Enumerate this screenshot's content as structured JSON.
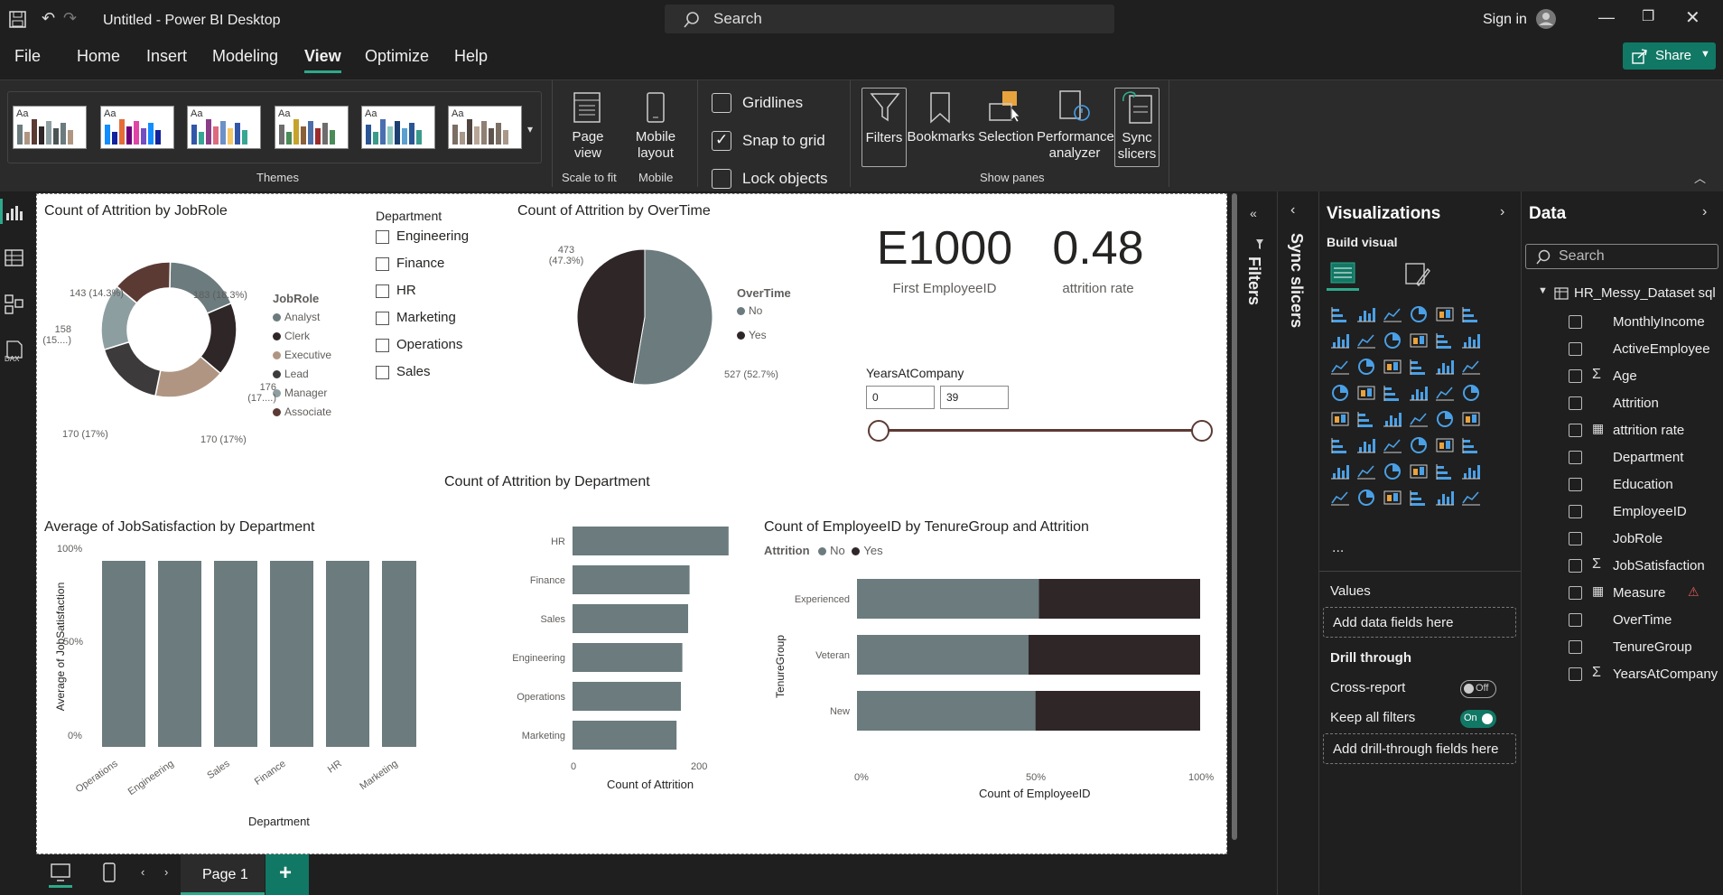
{
  "app": {
    "title": "Untitled - Power BI Desktop",
    "search_placeholder": "Search",
    "sign_in": "Sign in"
  },
  "menu": {
    "items": [
      "File",
      "Home",
      "Insert",
      "Modeling",
      "View",
      "Optimize",
      "Help"
    ],
    "active": "View",
    "share": "Share"
  },
  "ribbon": {
    "themes_label": "Themes",
    "theme_text": "Aa",
    "page_view": "Page view",
    "scale_to_fit": "Scale to fit",
    "mobile_layout": "Mobile layout",
    "mobile": "Mobile",
    "gridlines": "Gridlines",
    "snap_to_grid": "Snap to grid",
    "lock_objects": "Lock objects",
    "gridlines_checked": false,
    "snap_checked": true,
    "lock_checked": false,
    "panes": [
      "Filters",
      "Bookmarks",
      "Selection",
      "Performance analyzer",
      "Sync slicers"
    ],
    "show_panes": "Show panes"
  },
  "report": {
    "donut": {
      "title": "Count of Attrition by JobRole",
      "legend_title": "JobRole",
      "legend": [
        "Analyst",
        "Clerk",
        "Executive",
        "Lead",
        "Manager",
        "Associate"
      ],
      "labels": [
        "183 (18.3%)",
        "176 (17....)",
        "170 (17%)",
        "170 (17%)",
        "158 (15....)",
        "143 (14.3%)"
      ]
    },
    "dept_slicer": {
      "title": "Department",
      "items": [
        "Engineering",
        "Finance",
        "HR",
        "Marketing",
        "Operations",
        "Sales"
      ]
    },
    "pie": {
      "title": "Count of Attrition by OverTime",
      "legend_title": "OverTime",
      "legend": [
        "No",
        "Yes"
      ],
      "labels": [
        "473 (47.3%)",
        "527 (52.7%)"
      ]
    },
    "card1": {
      "value": "E1000",
      "label": "First EmployeeID"
    },
    "card2": {
      "value": "0.48",
      "label": "attrition rate"
    },
    "years_slicer": {
      "title": "YearsAtCompany",
      "min": "0",
      "max": "39"
    },
    "bar_dept": {
      "title": "Count of Attrition by Department",
      "xlabel": "Count of Attrition",
      "ticks": [
        "0",
        "200"
      ]
    },
    "col_sat": {
      "title": "Average of JobSatisfaction by Department",
      "ylabel": "Average of JobSatisfaction",
      "xlabel": "Department",
      "yticks": [
        "100%",
        "50%",
        "0%"
      ]
    },
    "stacked": {
      "title": "Count of EmployeeID by TenureGroup and Attrition",
      "legend_title": "Attrition",
      "legend": [
        "No",
        "Yes"
      ],
      "ylabel": "TenureGroup",
      "xlabel": "Count of EmployeeID",
      "ticks": [
        "0%",
        "50%",
        "100%"
      ]
    }
  },
  "chart_data": [
    {
      "type": "pie",
      "title": "Count of Attrition by JobRole",
      "categories": [
        "Analyst",
        "Clerk",
        "Executive",
        "Lead",
        "Manager",
        "Associate"
      ],
      "values": [
        183,
        176,
        170,
        170,
        158,
        143
      ],
      "colors": [
        "#6b7b7e",
        "#2f2628",
        "#b09682",
        "#3d3a3b",
        "#8d9ea1",
        "#5c3a34"
      ]
    },
    {
      "type": "pie",
      "title": "Count of Attrition by OverTime",
      "categories": [
        "No",
        "Yes"
      ],
      "values": [
        527,
        473
      ],
      "colors": [
        "#6b7b7e",
        "#2f2628"
      ]
    },
    {
      "type": "bar",
      "title": "Count of Attrition by Department",
      "categories": [
        "HR",
        "Finance",
        "Sales",
        "Engineering",
        "Operations",
        "Marketing"
      ],
      "values": [
        216,
        162,
        160,
        152,
        150,
        144
      ],
      "xlim": [
        0,
        240
      ],
      "xlabel": "Count of Attrition"
    },
    {
      "type": "bar",
      "title": "Average of JobSatisfaction by Department",
      "categories": [
        "Operations",
        "Engineering",
        "Sales",
        "Finance",
        "HR",
        "Marketing"
      ],
      "values": [
        100,
        100,
        100,
        100,
        100,
        100
      ],
      "ylim": [
        0,
        100
      ],
      "xlabel": "Department",
      "ylabel": "Average of JobSatisfaction"
    },
    {
      "type": "bar",
      "title": "Count of EmployeeID by TenureGroup and Attrition",
      "categories": [
        "Experienced",
        "Veteran",
        "New"
      ],
      "series": [
        {
          "name": "No",
          "values": [
            53,
            50,
            52
          ]
        },
        {
          "name": "Yes",
          "values": [
            47,
            50,
            48
          ]
        }
      ],
      "xlim": [
        0,
        100
      ],
      "xlabel": "Count of EmployeeID",
      "ylabel": "TenureGroup"
    }
  ],
  "pagebar": {
    "page": "Page 1"
  },
  "panes": {
    "filters": "Filters",
    "sync": "Sync slicers"
  },
  "viz": {
    "title": "Visualizations",
    "build": "Build visual",
    "values": "Values",
    "add_values": "Add data fields here",
    "drill": "Drill through",
    "cross_report": "Cross-report",
    "cross_state": "Off",
    "keep_filters": "Keep all filters",
    "keep_state": "On",
    "add_drill": "Add drill-through fields here",
    "more": "..."
  },
  "data": {
    "title": "Data",
    "search_placeholder": "Search",
    "table": "HR_Messy_Dataset sql",
    "fields": [
      "MonthlyIncome",
      "ActiveEmployee",
      "Age",
      "Attrition",
      "attrition rate",
      "Department",
      "Education",
      "EmployeeID",
      "JobRole",
      "JobSatisfaction",
      "Measure",
      "OverTime",
      "TenureGroup",
      "YearsAtCompany"
    ]
  }
}
